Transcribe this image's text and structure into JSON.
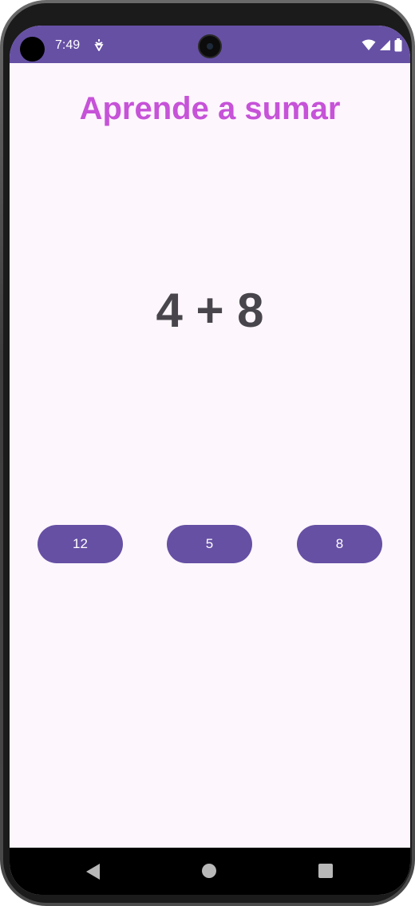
{
  "status_bar": {
    "time": "7:49",
    "icons": [
      "notification-icon",
      "wifi-icon",
      "signal-icon",
      "battery-icon"
    ],
    "background_color": "#6650a4"
  },
  "app": {
    "title": "Aprende a sumar",
    "title_color": "#c653d8",
    "equation": "4 + 8",
    "answers": [
      "12",
      "5",
      "8"
    ],
    "button_color": "#6650a4",
    "background_color": "#fef6fd"
  },
  "nav_bar": {
    "icons": [
      "back-icon",
      "home-icon",
      "recents-icon"
    ]
  }
}
